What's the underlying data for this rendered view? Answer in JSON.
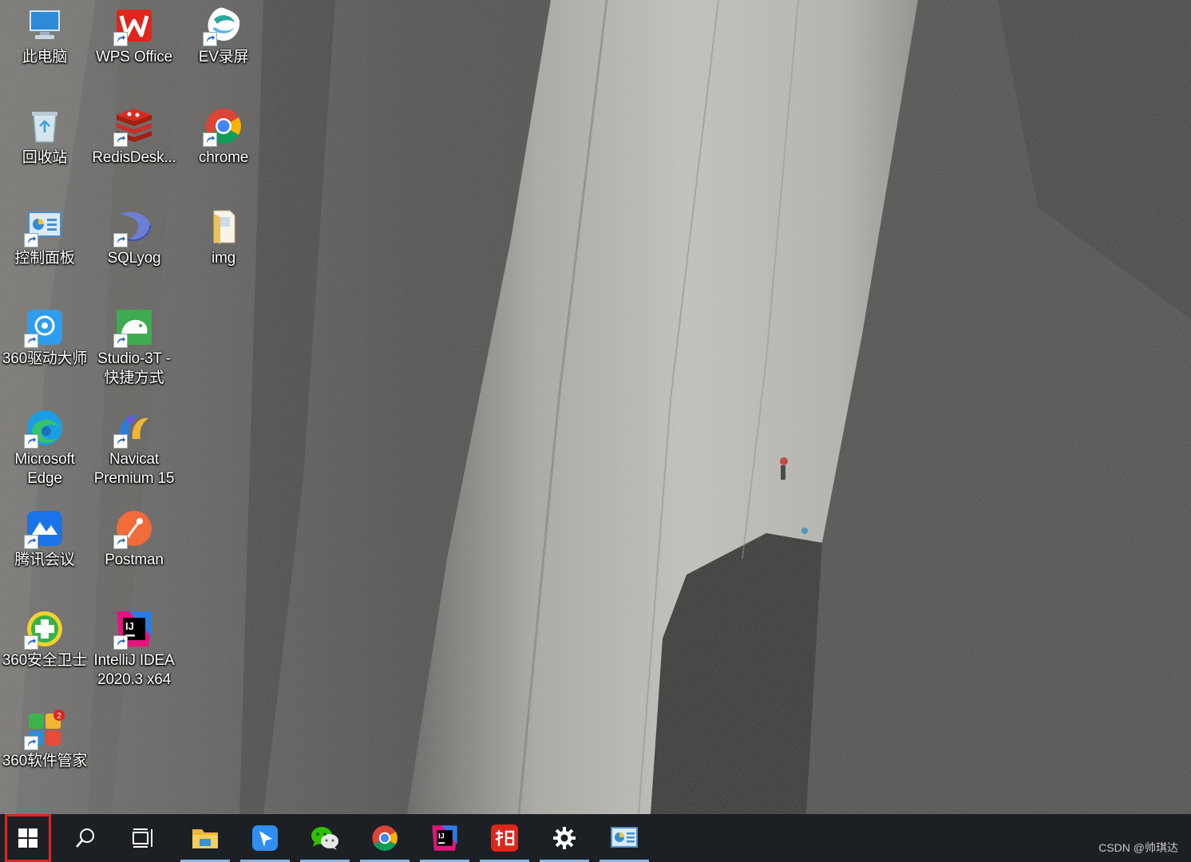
{
  "desktop": {
    "icons": [
      {
        "label": "此电脑",
        "icon": "this-pc-icon"
      },
      {
        "label": "WPS Office",
        "icon": "wps-office-icon"
      },
      {
        "label": "EV录屏",
        "icon": "ev-recorder-icon"
      },
      {
        "label": "回收站",
        "icon": "recycle-bin-icon"
      },
      {
        "label": "RedisDesk...",
        "icon": "redis-desktop-icon"
      },
      {
        "label": "chrome",
        "icon": "chrome-icon"
      },
      {
        "label": "控制面板",
        "icon": "control-panel-icon"
      },
      {
        "label": "SQLyog",
        "icon": "sqlyog-icon"
      },
      {
        "label": "img",
        "icon": "folder-icon"
      },
      {
        "label": "360驱动大师",
        "icon": "driver-master-icon"
      },
      {
        "label": "Studio-3T -\n快捷方式",
        "icon": "studio-3t-icon"
      },
      {
        "label": "Microsoft\nEdge",
        "icon": "edge-icon"
      },
      {
        "label": "Navicat\nPremium 15",
        "icon": "navicat-icon"
      },
      {
        "label": "腾讯会议",
        "icon": "tencent-meeting-icon"
      },
      {
        "label": "Postman",
        "icon": "postman-icon"
      },
      {
        "label": "360安全卫士",
        "icon": "360-security-icon"
      },
      {
        "label": "IntelliJ IDEA\n2020.3 x64",
        "icon": "intellij-icon"
      },
      {
        "label": "360软件管家",
        "icon": "360-software-manager-icon"
      }
    ]
  },
  "taskbar": {
    "items": [
      {
        "name": "start",
        "icon": "windows-start-icon",
        "running": false
      },
      {
        "name": "search",
        "icon": "search-icon",
        "running": false
      },
      {
        "name": "task-view",
        "icon": "task-view-icon",
        "running": false
      },
      {
        "name": "file-explorer",
        "icon": "folder-icon",
        "running": true
      },
      {
        "name": "feishu",
        "icon": "feishu-icon",
        "running": true
      },
      {
        "name": "wechat",
        "icon": "wechat-icon",
        "running": true
      },
      {
        "name": "chrome",
        "icon": "chrome-icon",
        "running": true
      },
      {
        "name": "intellij",
        "icon": "intellij-icon",
        "running": true
      },
      {
        "name": "youdao",
        "icon": "youdao-icon",
        "running": true
      },
      {
        "name": "settings",
        "icon": "gear-icon",
        "running": true
      },
      {
        "name": "control-panel",
        "icon": "control-panel-icon",
        "running": true
      }
    ]
  },
  "watermark": "CSDN @帅琪达",
  "colors": {
    "taskbar": "#1c1f24",
    "start_highlight": "#e0251b",
    "running_indicator": "#7fb6e6"
  }
}
